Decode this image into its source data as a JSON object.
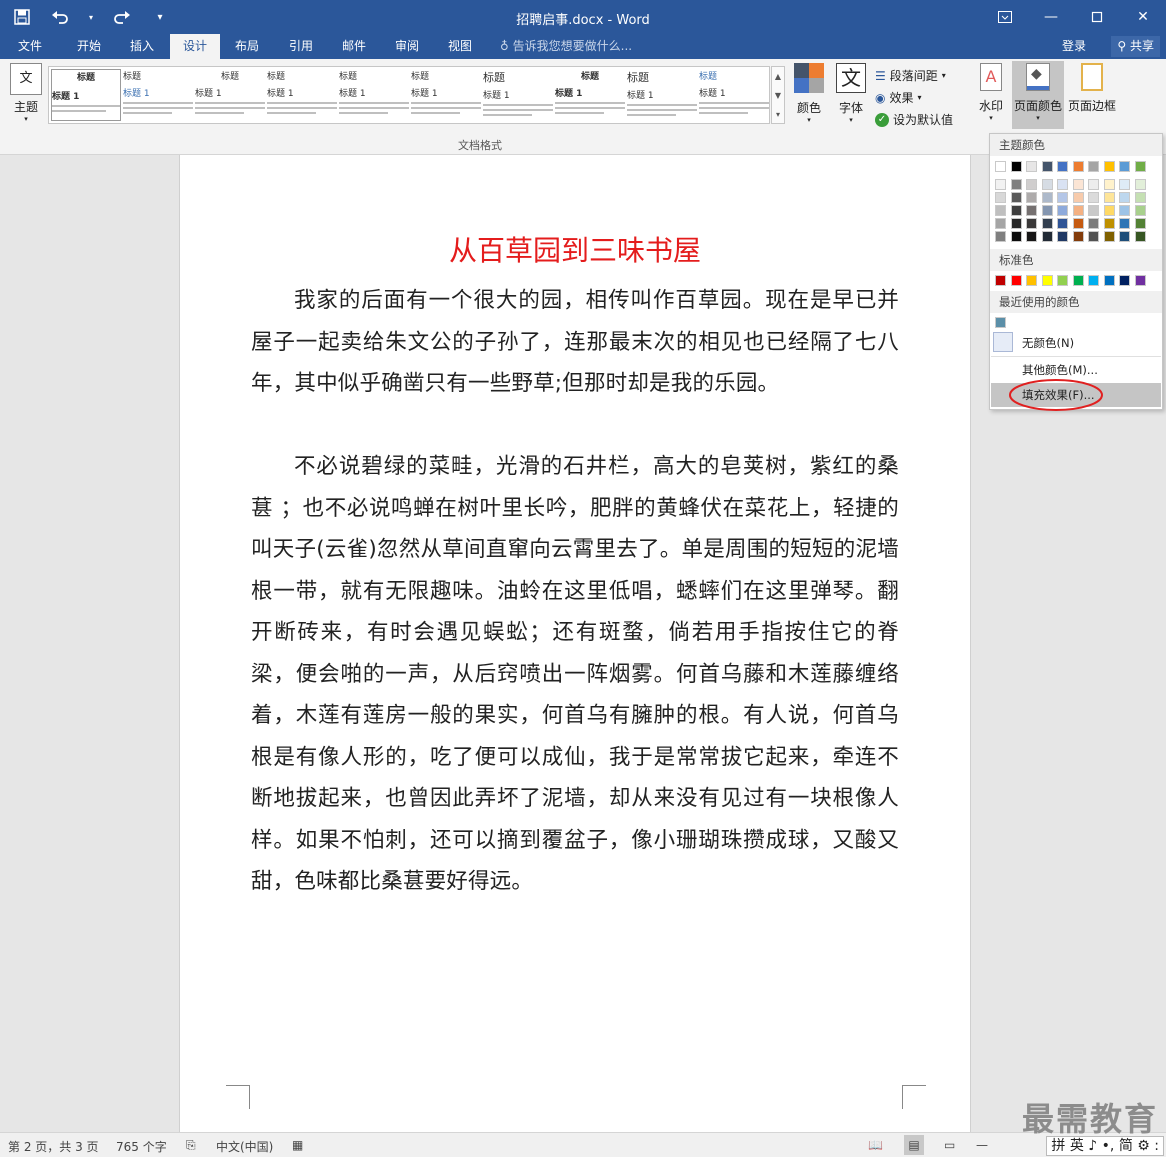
{
  "titlebar": {
    "title": "招聘启事.docx - Word",
    "qat": [
      "save",
      "undo",
      "redo",
      "customize"
    ]
  },
  "tabs": [
    "文件",
    "开始",
    "插入",
    "设计",
    "布局",
    "引用",
    "邮件",
    "审阅",
    "视图"
  ],
  "active_tab": "设计",
  "tellme": "告诉我您想要做什么...",
  "account": {
    "login": "登录",
    "share": "共享"
  },
  "ribbon": {
    "theme_label": "主题",
    "gallery_styles": [
      {
        "h": "标题",
        "h1": "标题 1"
      },
      {
        "h": "标题",
        "h1": "标题 1"
      },
      {
        "h": "标题",
        "h1": "标题 1"
      },
      {
        "h": "标题",
        "h1": "标题 1"
      },
      {
        "h": "标题",
        "h1": "标题 1"
      },
      {
        "h": "标题",
        "h1": "标题 1"
      },
      {
        "h": "标题",
        "h1": "标题 1"
      },
      {
        "h": "标题",
        "h1": "标题 1"
      },
      {
        "h": "标题",
        "h1": "标题 1"
      },
      {
        "h": "标题",
        "h1": "标题 1"
      }
    ],
    "colors_label": "颜色",
    "fonts_label": "字体",
    "fonts_icon_char": "文",
    "paragraph_spacing": "段落间距",
    "effects": "效果",
    "set_default": "设为默认值",
    "watermark": "水印",
    "page_color": "页面颜色",
    "page_borders": "页面边框",
    "group_label": "文档格式"
  },
  "document": {
    "title": "从百草园到三味书屋",
    "paragraphs": [
      "我家的后面有一个很大的园，相传叫作百草园。现在是早已并屋子一起卖给朱文公的子孙了，连那最末次的相见也已经隔了七八年，其中似乎确凿只有一些野草;但那时却是我的乐园。",
      "不必说碧绿的菜畦，光滑的石井栏，高大的皂荚树，紫红的桑葚 ；也不必说鸣蝉在树叶里长吟，肥胖的黄蜂伏在菜花上，轻捷的叫天子(云雀)忽然从草间直窜向云霄里去了。单是周围的短短的泥墙根一带，就有无限趣味。油蛉在这里低唱，蟋蟀们在这里弹琴。翻开断砖来，有时会遇见蜈蚣；还有斑蝥，倘若用手指按住它的脊梁，便会啪的一声，从后窍喷出一阵烟雾。何首乌藤和木莲藤缠络着，木莲有莲房一般的果实，何首乌有臃肿的根。有人说，何首乌根是有像人形的，吃了便可以成仙，我于是常常拔它起来，牵连不断地拔起来，也曾因此弄坏了泥墙，却从来没有见过有一块根像人样。如果不怕刺，还可以摘到覆盆子，像小珊瑚珠攒成球，又酸又甜，色味都比桑葚要好得远。"
    ],
    "title_color": "#e41c1c"
  },
  "color_menu": {
    "theme_colors_label": "主题颜色",
    "theme_colors": [
      "#ffffff",
      "#000000",
      "#e7e6e6",
      "#44546a",
      "#4472c4",
      "#ed7d31",
      "#a5a5a5",
      "#ffc000",
      "#5b9bd5",
      "#70ad47"
    ],
    "theme_shades": [
      [
        "#f2f2f2",
        "#7f7f7f",
        "#d0cece",
        "#d6dce4",
        "#d9e2f3",
        "#fbe5d5",
        "#ededed",
        "#fff2cc",
        "#deebf6",
        "#e2efd9"
      ],
      [
        "#d8d8d8",
        "#595959",
        "#aeabab",
        "#adb9ca",
        "#b4c6e7",
        "#f7cbac",
        "#dbdbdb",
        "#fee599",
        "#bdd7ee",
        "#c5e0b3"
      ],
      [
        "#bfbfbf",
        "#3f3f3f",
        "#757070",
        "#8496b0",
        "#8eaadb",
        "#f4b183",
        "#c9c9c9",
        "#ffd965",
        "#9dc3e6",
        "#a8d08d"
      ],
      [
        "#a5a5a5",
        "#262626",
        "#3a3838",
        "#323f4f",
        "#2f5496",
        "#c55a11",
        "#7b7b7b",
        "#bf9000",
        "#2e75b5",
        "#538135"
      ],
      [
        "#7f7f7f",
        "#0c0c0c",
        "#171616",
        "#222a35",
        "#1f3864",
        "#833c0b",
        "#525252",
        "#7f6000",
        "#1e4e79",
        "#375623"
      ]
    ],
    "standard_colors_label": "标准色",
    "standard_colors": [
      "#c00000",
      "#ff0000",
      "#ffc000",
      "#ffff00",
      "#92d050",
      "#00b050",
      "#00b0f0",
      "#0070c0",
      "#002060",
      "#7030a0"
    ],
    "recent_label": "最近使用的颜色",
    "recent_colors": [
      "#5b8fa8"
    ],
    "no_color": "无颜色(N)",
    "more_colors": "其他颜色(M)...",
    "fill_effects": "填充效果(F)..."
  },
  "statusbar": {
    "page": "第 2 页，共 3 页",
    "words": "765 个字",
    "language": "中文(中国)"
  },
  "watermark_text": "最需教育",
  "ime": "拼 英 ♪ •, 简 ⚙ :"
}
